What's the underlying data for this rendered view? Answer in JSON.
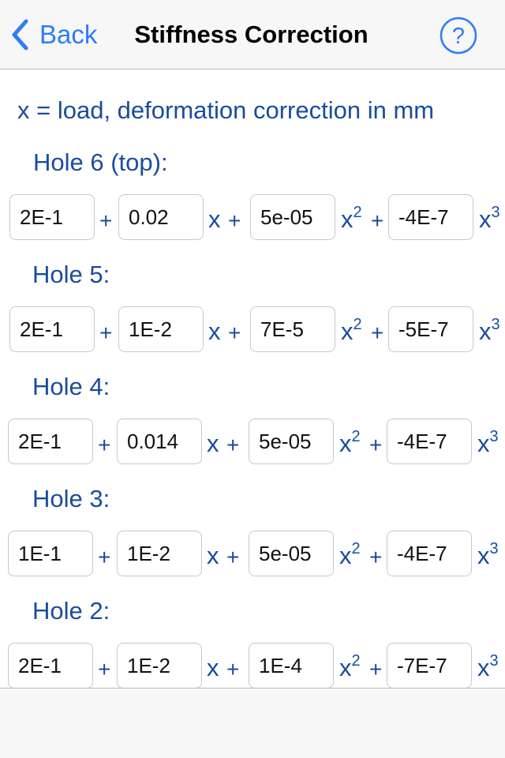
{
  "nav": {
    "back_label": "Back",
    "title": "Stiffness Correction",
    "help_label": "?"
  },
  "colors": {
    "accent": "#2f7cf6",
    "label": "#1a4c9e",
    "navbar_bg": "#f7f7f8"
  },
  "note": "x = load, deformation correction in mm",
  "operators": {
    "plus": "+",
    "x": "x",
    "x2": "x",
    "x3": "x",
    "sq": "2",
    "cube": "3"
  },
  "holes": [
    {
      "label": "Hole 6 (top):",
      "coefficients": [
        "2E-1",
        "0.02",
        "5e-05",
        "-4E-7"
      ]
    },
    {
      "label": "Hole 5:",
      "coefficients": [
        "2E-1",
        "1E-2",
        "7E-5",
        "-5E-7"
      ]
    },
    {
      "label": "Hole 4:",
      "coefficients": [
        "2E-1",
        "0.014",
        "5e-05",
        "-4E-7"
      ]
    },
    {
      "label": "Hole 3:",
      "coefficients": [
        "1E-1",
        "1E-2",
        "5e-05",
        "-4E-7"
      ]
    },
    {
      "label": "Hole 2:",
      "coefficients": [
        "2E-1",
        "1E-2",
        "1E-4",
        "-7E-7"
      ]
    }
  ]
}
